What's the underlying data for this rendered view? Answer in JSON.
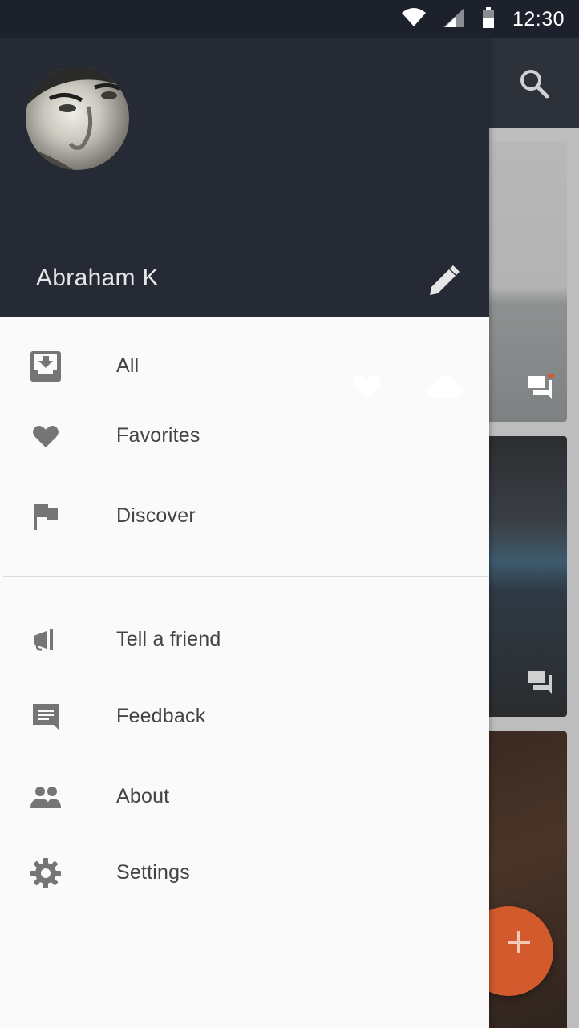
{
  "status_bar": {
    "time": "12:30"
  },
  "drawer": {
    "user_name": "Abraham K",
    "primary_items": [
      {
        "label": "All",
        "icon": "inbox-download-icon"
      },
      {
        "label": "Favorites",
        "icon": "heart-icon"
      },
      {
        "label": "Discover",
        "icon": "flag-icon"
      }
    ],
    "secondary_items": [
      {
        "label": "Tell a friend",
        "icon": "megaphone-icon"
      },
      {
        "label": "Feedback",
        "icon": "feedback-icon"
      },
      {
        "label": "About",
        "icon": "people-icon"
      },
      {
        "label": "Settings",
        "icon": "gear-icon"
      }
    ]
  },
  "colors": {
    "header_bg": "#252a35",
    "drawer_bg": "#fafafa",
    "icon_gray": "#757575",
    "fab_accent": "#d25a2c"
  }
}
